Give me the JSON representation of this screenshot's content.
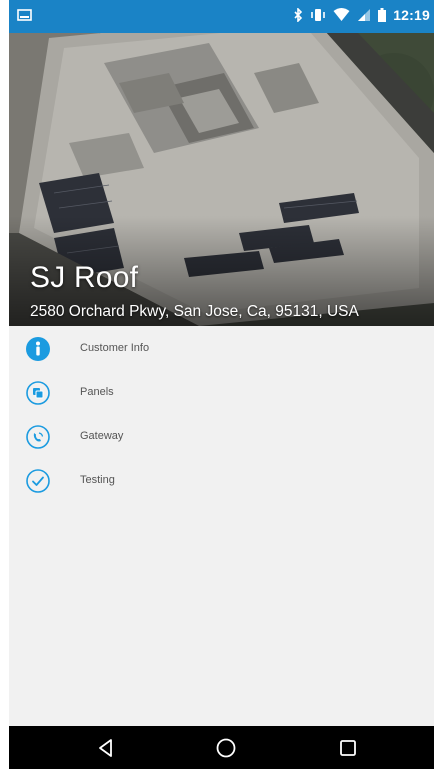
{
  "status_bar": {
    "time": "12:19",
    "color": "#1a83c6",
    "icons": [
      "image-icon",
      "bluetooth-icon",
      "vibrate-icon",
      "wifi-icon",
      "signal-icon",
      "battery-icon"
    ]
  },
  "header": {
    "title": "SJ Roof",
    "address": "2580 Orchard Pkwy, San Jose, Ca, 95131, USA"
  },
  "menu": {
    "items": [
      {
        "label": "Customer Info",
        "icon": "info-icon"
      },
      {
        "label": "Panels",
        "icon": "panels-icon"
      },
      {
        "label": "Gateway",
        "icon": "gateway-icon"
      },
      {
        "label": "Testing",
        "icon": "check-icon"
      }
    ],
    "accent": "#1b9be0"
  },
  "nav_bar": {
    "buttons": [
      "back-icon",
      "home-icon",
      "recents-icon"
    ]
  }
}
